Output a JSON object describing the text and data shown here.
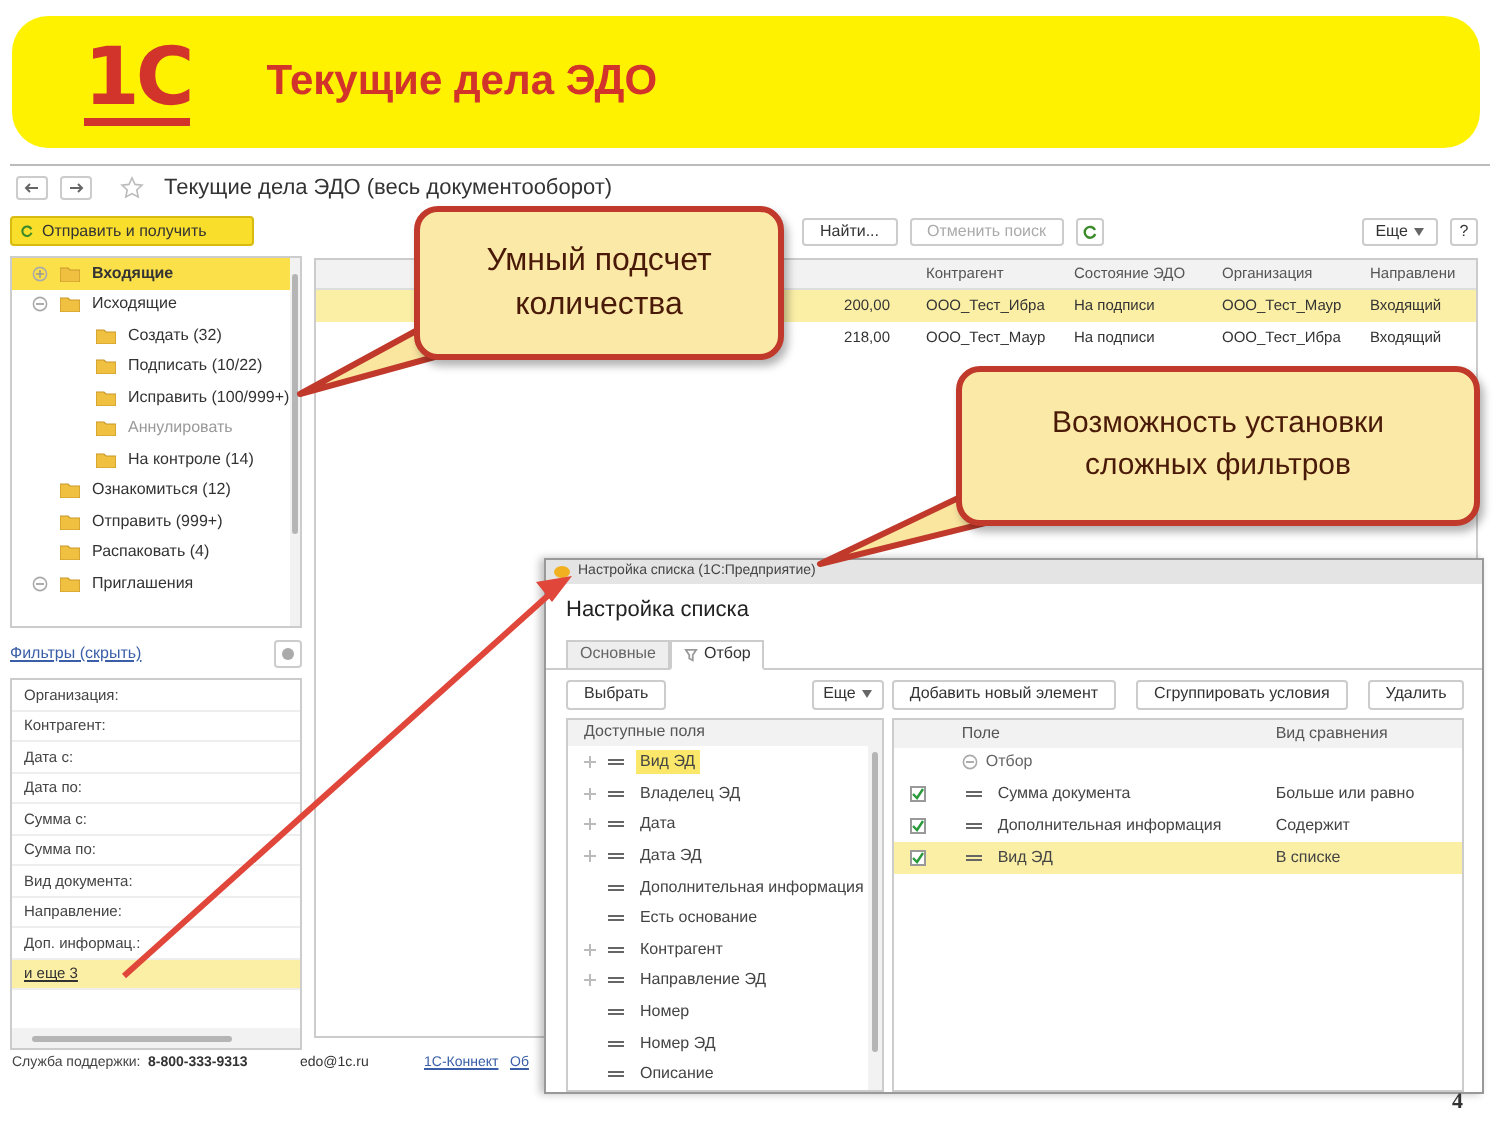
{
  "slide": {
    "logo": "1С",
    "title": "Текущие дела ЭДО",
    "page_number": "4"
  },
  "window": {
    "title": "Текущие дела ЭДО (весь документооборот)"
  },
  "send_button": "Отправить и получить",
  "folders": [
    {
      "label": "Входящие",
      "selected": true,
      "disabled": false,
      "expanded": false
    },
    {
      "label": "Исходящие",
      "selected": false,
      "disabled": false,
      "expanded": true,
      "children": [
        {
          "label": "Создать (32)",
          "selected": false,
          "disabled": false
        },
        {
          "label": "Подписать (10/22)",
          "selected": false,
          "disabled": false
        },
        {
          "label": "Исправить (100/999+)",
          "selected": false,
          "disabled": false
        },
        {
          "label": "Аннулировать",
          "selected": false,
          "disabled": true
        },
        {
          "label": "На контроле (14)",
          "selected": false,
          "disabled": false
        }
      ]
    },
    {
      "label": "Ознакомиться (12)",
      "selected": false,
      "disabled": false
    },
    {
      "label": "Отправить (999+)",
      "selected": false,
      "disabled": false
    },
    {
      "label": "Распаковать (4)",
      "selected": false,
      "disabled": false
    },
    {
      "label": "Приглашения",
      "selected": false,
      "disabled": false,
      "expanded": true
    }
  ],
  "filters_link": "Фильтры (скрыть)",
  "filters": [
    {
      "label": "Организация:",
      "selected": false
    },
    {
      "label": "Контрагент:",
      "selected": false
    },
    {
      "label": "Дата с:",
      "selected": false
    },
    {
      "label": "Дата по:",
      "selected": false
    },
    {
      "label": "Сумма с:",
      "selected": false
    },
    {
      "label": "Сумма по:",
      "selected": false
    },
    {
      "label": "Вид документа:",
      "selected": false
    },
    {
      "label": "Направление:",
      "selected": false
    },
    {
      "label": "Доп. информац.:",
      "selected": false
    },
    {
      "label": "и еще 3",
      "selected": true,
      "kind": "link"
    }
  ],
  "toolbar": {
    "buttons": [
      {
        "label": "Найти...",
        "disabled": false
      },
      {
        "label": "Отменить поиск",
        "disabled": true
      }
    ],
    "more": "Еще",
    "help": "?"
  },
  "table": {
    "columns": [
      "Контрагент",
      "Состояние ЭДО",
      "Организация",
      "Направлени"
    ],
    "rows": [
      {
        "sum": "200,00",
        "cells": [
          "ООО_Тест_Ибра",
          "На подписи",
          "ООО_Тест_Маур",
          "Входящий"
        ],
        "selected": true
      },
      {
        "sum": "218,00",
        "cells": [
          "ООО_Тест_Маур",
          "На подписи",
          "ООО_Тест_Ибра",
          "Входящий"
        ],
        "selected": false
      }
    ]
  },
  "footer": {
    "support_label": "Служба поддержки:",
    "phone": "8-800-333-9313",
    "email": "edo@1c.ru",
    "links": [
      "1С-Коннект",
      "Об"
    ]
  },
  "dialog": {
    "title": "Настройка списка (1С:Предприятие)",
    "heading": "Настройка списка",
    "tabs": [
      {
        "label": "Основные",
        "selected": false
      },
      {
        "label": "Отбор",
        "selected": true
      }
    ],
    "left_buttons": {
      "choose": "Выбрать",
      "more": "Еще"
    },
    "fields_header": "Доступные поля",
    "fields": [
      {
        "label": "Вид ЭД",
        "expandable": true,
        "selected": true
      },
      {
        "label": "Владелец ЭД",
        "expandable": true,
        "selected": false
      },
      {
        "label": "Дата",
        "expandable": true,
        "selected": false
      },
      {
        "label": "Дата ЭД",
        "expandable": true,
        "selected": false
      },
      {
        "label": "Дополнительная информация",
        "expandable": false,
        "selected": false
      },
      {
        "label": "Есть основание",
        "expandable": false,
        "selected": false
      },
      {
        "label": "Контрагент",
        "expandable": true,
        "selected": false
      },
      {
        "label": "Направление ЭД",
        "expandable": true,
        "selected": false
      },
      {
        "label": "Номер",
        "expandable": false,
        "selected": false
      },
      {
        "label": "Номер ЭД",
        "expandable": false,
        "selected": false
      },
      {
        "label": "Описание",
        "expandable": false,
        "selected": false
      }
    ],
    "right_buttons": [
      "Добавить новый элемент",
      "Сгруппировать условия",
      "Удалить"
    ],
    "columns": [
      "Поле",
      "Вид сравнения"
    ],
    "group": "Отбор",
    "conditions": [
      {
        "checked": true,
        "field": "Сумма документа",
        "comparison": "Больше или равно",
        "selected": false
      },
      {
        "checked": true,
        "field": "Дополнительная информация",
        "comparison": "Содержит",
        "selected": false
      },
      {
        "checked": true,
        "field": "Вид ЭД",
        "comparison": "В списке",
        "selected": true
      }
    ]
  },
  "callouts": [
    {
      "text": "Умный подсчет количества"
    },
    {
      "text": "Возможность установки сложных фильтров"
    }
  ]
}
